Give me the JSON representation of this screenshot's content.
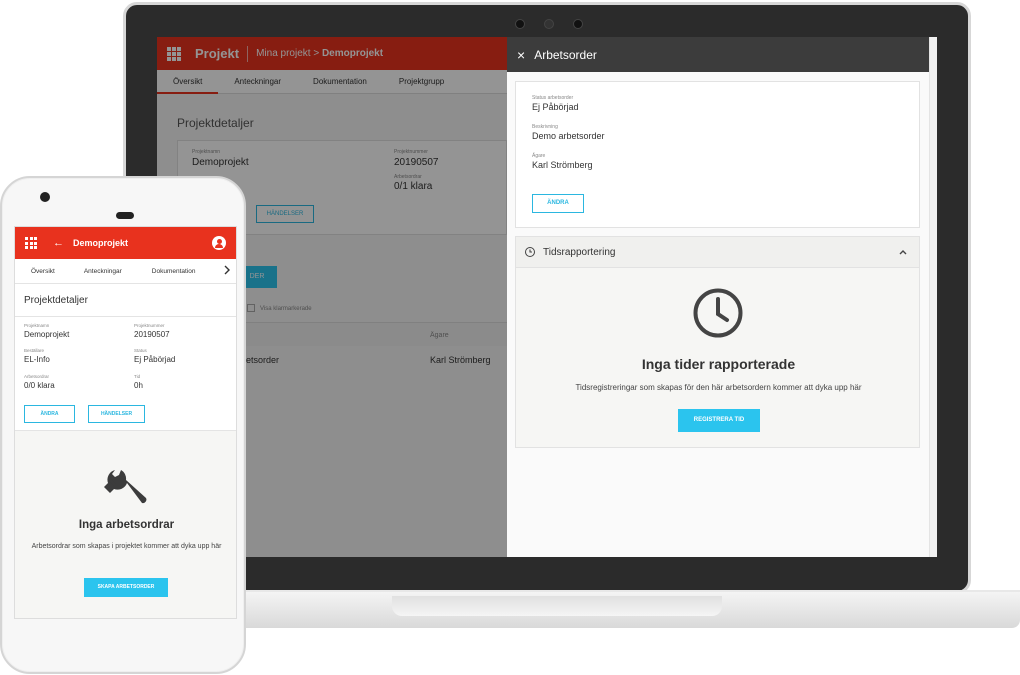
{
  "desktop": {
    "header": {
      "app_title": "Projekt",
      "breadcrumb_parent": "Mina projekt",
      "breadcrumb_separator": ">",
      "breadcrumb_current": "Demoprojekt"
    },
    "tabs": [
      "Översikt",
      "Anteckningar",
      "Dokumentation",
      "Projektgrupp"
    ],
    "section_title": "Projektdetaljer",
    "card": {
      "name_label": "Projektnamn",
      "name_value": "Demoprojekt",
      "number_label": "Projektnummer",
      "number_value": "20190507",
      "workorders_label": "Arbetsordrar",
      "workorders_value": "0/1 klara",
      "events_button": "HÄNDELSER"
    },
    "create_button_fragment": "DER",
    "show_completed_label": "Visa klarmarkerade",
    "table": {
      "owner_header": "Ägare",
      "row_name_fragment": "betsorder",
      "row_owner": "Karl Strömberg"
    },
    "panel": {
      "title": "Arbetsorder",
      "close_icon": "×",
      "status_label": "Status arbetsorder",
      "status_value": "Ej Påbörjad",
      "description_label": "Beskrivning",
      "description_value": "Demo arbetsorder",
      "owner_label": "Ägare",
      "owner_value": "Karl Strömberg",
      "edit_button": "ÄNDRA",
      "time_section_title": "Tidsrapportering",
      "empty_title": "Inga tider rapporterade",
      "empty_text": "Tidsregistreringar som skapas för den här arbetsordern kommer att dyka upp här",
      "register_button": "REGISTRERA TID"
    }
  },
  "phone": {
    "header_title": "Demoprojekt",
    "back_icon": "←",
    "tabs": [
      "Översikt",
      "Anteckningar",
      "Dokumentation"
    ],
    "tabs_more_icon": "›",
    "section_title": "Projektdetaljer",
    "fields": {
      "name_label": "Projektnamn",
      "name_value": "Demoprojekt",
      "number_label": "Projektnummer",
      "number_value": "20190507",
      "client_label": "Beställare",
      "client_value": "EL-Info",
      "status_label": "Status",
      "status_value": "Ej Påbörjad",
      "workorders_label": "Arbetsordrar",
      "workorders_value": "0/0 klara",
      "time_label": "Tid",
      "time_value": "0h"
    },
    "edit_button": "ÄNDRA",
    "events_button": "HÄNDELSER",
    "empty_title": "Inga arbetsordrar",
    "empty_text": "Arbetsordrar som skapas i projektet kommer att dyka upp här",
    "create_button": "SKAPA ARBETSORDER"
  },
  "colors": {
    "brand_red": "#e8321e",
    "accent_blue": "#2bc4ee",
    "panel_header": "#3c3c3c"
  }
}
